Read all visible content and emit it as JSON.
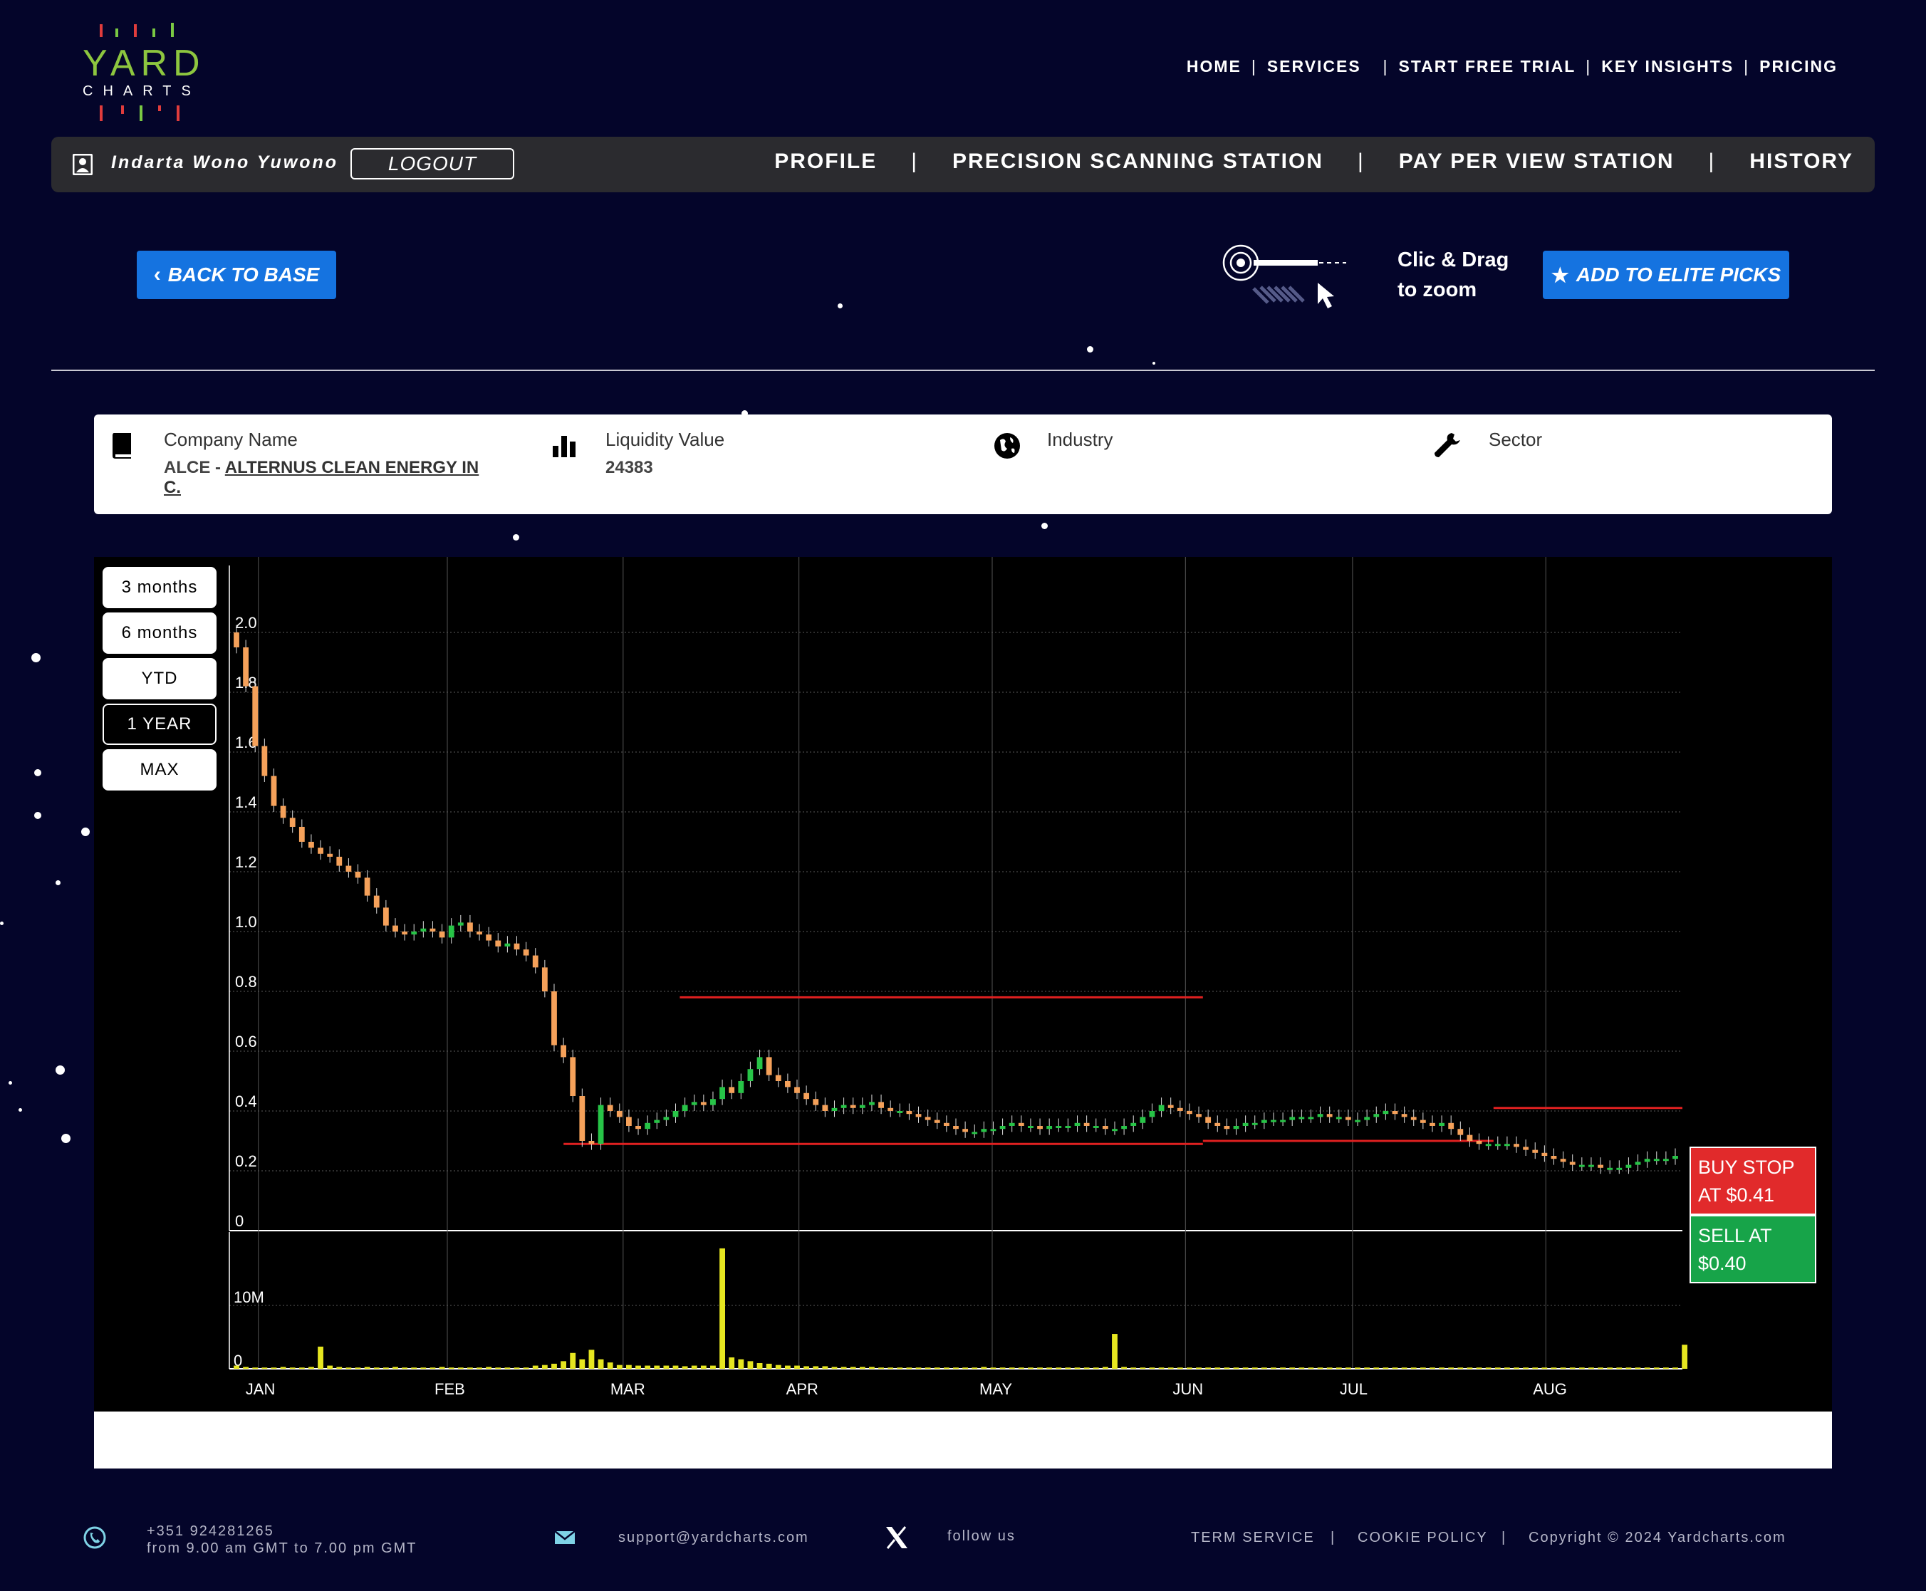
{
  "header": {
    "logo_word": "YARD",
    "logo_sub": "CHARTS",
    "nav": [
      "HOME",
      "SERVICES",
      "START FREE TRIAL",
      "KEY INSIGHTS",
      "PRICING"
    ]
  },
  "userbar": {
    "user_name": "Indarta Wono Yuwono",
    "logout_label": "LOGOUT",
    "nav": [
      "PROFILE",
      "PRECISION SCANNING STATION",
      "PAY PER VIEW STATION",
      "HISTORY"
    ]
  },
  "actions": {
    "back_label": "BACK TO BASE",
    "zoom_line1": "Clic & Drag",
    "zoom_line2": "to zoom",
    "elite_label": "ADD TO ELITE PICKS"
  },
  "info": {
    "company_label": "Company Name",
    "ticker": "ALCE - ",
    "company_name_line1": "ALTERNUS CLEAN ENERGY IN",
    "company_name_line2": "C.",
    "liquidity_label": "Liquidity Value",
    "liquidity_value": "24383",
    "industry_label": "Industry",
    "sector_label": "Sector"
  },
  "range_buttons": [
    "3 months",
    "6 months",
    "YTD",
    "1 YEAR",
    "MAX"
  ],
  "active_range": "1 YEAR",
  "badges": {
    "buy_line1": "BUY STOP",
    "buy_line2": "AT $0.41",
    "sell_line1": "SELL AT",
    "sell_line2": "$0.40"
  },
  "chart_data": {
    "type": "candlestick",
    "price_ticks": [
      "0",
      "0.2",
      "0.4",
      "0.6",
      "0.8",
      "1.0",
      "1.2",
      "1.4",
      "1.6",
      "1.8",
      "2.0"
    ],
    "price_range": [
      0,
      2.2
    ],
    "volume_ticks": [
      "0",
      "10M"
    ],
    "months": [
      "JAN",
      "FEB",
      "MAR",
      "APR",
      "MAY",
      "JUN",
      "JUL",
      "AUG"
    ],
    "colors": {
      "up": "#27c447",
      "down": "#f5a15a",
      "volume": "#e6e620",
      "level": "#e02020",
      "grid": "#5a5a5a"
    },
    "close_series": [
      1.95,
      1.82,
      1.62,
      1.52,
      1.42,
      1.38,
      1.35,
      1.3,
      1.28,
      1.26,
      1.25,
      1.22,
      1.2,
      1.18,
      1.12,
      1.08,
      1.02,
      1.0,
      0.99,
      1.0,
      1.01,
      1.0,
      0.98,
      1.02,
      1.03,
      1.0,
      0.99,
      0.97,
      0.95,
      0.96,
      0.94,
      0.92,
      0.88,
      0.8,
      0.62,
      0.58,
      0.45,
      0.3,
      0.29,
      0.42,
      0.4,
      0.38,
      0.35,
      0.34,
      0.36,
      0.37,
      0.38,
      0.4,
      0.42,
      0.43,
      0.42,
      0.44,
      0.48,
      0.46,
      0.5,
      0.54,
      0.58,
      0.52,
      0.5,
      0.48,
      0.46,
      0.44,
      0.42,
      0.4,
      0.41,
      0.42,
      0.41,
      0.42,
      0.43,
      0.41,
      0.4,
      0.4,
      0.39,
      0.38,
      0.37,
      0.36,
      0.35,
      0.34,
      0.33,
      0.33,
      0.34,
      0.34,
      0.35,
      0.36,
      0.35,
      0.35,
      0.34,
      0.35,
      0.35,
      0.35,
      0.36,
      0.35,
      0.35,
      0.34,
      0.34,
      0.35,
      0.36,
      0.38,
      0.4,
      0.42,
      0.41,
      0.4,
      0.39,
      0.38,
      0.36,
      0.35,
      0.34,
      0.35,
      0.36,
      0.36,
      0.37,
      0.37,
      0.37,
      0.38,
      0.38,
      0.38,
      0.39,
      0.38,
      0.38,
      0.37,
      0.37,
      0.38,
      0.39,
      0.4,
      0.39,
      0.38,
      0.37,
      0.36,
      0.35,
      0.36,
      0.34,
      0.32,
      0.3,
      0.29,
      0.29,
      0.29,
      0.29,
      0.28,
      0.27,
      0.26,
      0.25,
      0.24,
      0.23,
      0.22,
      0.22,
      0.22,
      0.21,
      0.21,
      0.21,
      0.22,
      0.23,
      0.24,
      0.24,
      0.24,
      0.25
    ],
    "volume_series": [
      0.5,
      0.3,
      0.2,
      0.2,
      0.2,
      0.3,
      0.2,
      0.2,
      0.3,
      3.5,
      0.5,
      0.3,
      0.2,
      0.2,
      0.3,
      0.2,
      0.2,
      0.3,
      0.2,
      0.2,
      0.2,
      0.2,
      0.3,
      0.2,
      0.2,
      0.2,
      0.2,
      0.3,
      0.2,
      0.2,
      0.2,
      0.2,
      0.5,
      0.6,
      0.8,
      1.2,
      2.5,
      1.5,
      3.0,
      1.5,
      1.0,
      0.6,
      0.6,
      0.5,
      0.5,
      0.5,
      0.5,
      0.5,
      0.4,
      0.5,
      0.5,
      0.5,
      19.0,
      1.8,
      1.5,
      1.2,
      0.9,
      0.8,
      0.6,
      0.5,
      0.5,
      0.4,
      0.4,
      0.4,
      0.3,
      0.3,
      0.3,
      0.3,
      0.3,
      0.2,
      0.2,
      0.2,
      0.2,
      0.2,
      0.2,
      0.2,
      0.2,
      0.2,
      0.2,
      0.2,
      0.3,
      0.2,
      0.2,
      0.2,
      0.2,
      0.2,
      0.2,
      0.2,
      0.2,
      0.2,
      0.2,
      0.2,
      0.2,
      0.3,
      5.5,
      0.3,
      0.2,
      0.2,
      0.2,
      0.2,
      0.2,
      0.2,
      0.2,
      0.2,
      0.2,
      0.2,
      0.2,
      0.2,
      0.2,
      0.2,
      0.2,
      0.2,
      0.2,
      0.2,
      0.2,
      0.2,
      0.2,
      0.2,
      0.2,
      0.2,
      0.2,
      0.2,
      0.2,
      0.2,
      0.2,
      0.2,
      0.2,
      0.2,
      0.2,
      0.2,
      0.2,
      0.2,
      0.2,
      0.2,
      0.2,
      0.2,
      0.2,
      0.2,
      0.2,
      0.2,
      0.2,
      0.2,
      0.2,
      0.2,
      0.2,
      0.2,
      0.2,
      0.2,
      0.2,
      0.2,
      0.2,
      0.2,
      0.2,
      0.2,
      0.2,
      3.8
    ],
    "levels": [
      {
        "y": 0.78,
        "from": 0.31,
        "to": 0.67
      },
      {
        "y": 0.29,
        "from": 0.23,
        "to": 0.67
      },
      {
        "y": 0.3,
        "from": 0.67,
        "to": 0.87
      },
      {
        "y": 0.41,
        "from": 0.87,
        "to": 1.0
      }
    ]
  },
  "footer": {
    "phone": "+351 924281265",
    "hours": "from 9.00 am GMT to 7.00 pm GMT",
    "email": "support@yardcharts.com",
    "follow": "follow us",
    "term": "TERM SERVICE",
    "cookie": "COOKIE POLICY",
    "copyright": "Copyright © 2024 Yardcharts.com"
  }
}
